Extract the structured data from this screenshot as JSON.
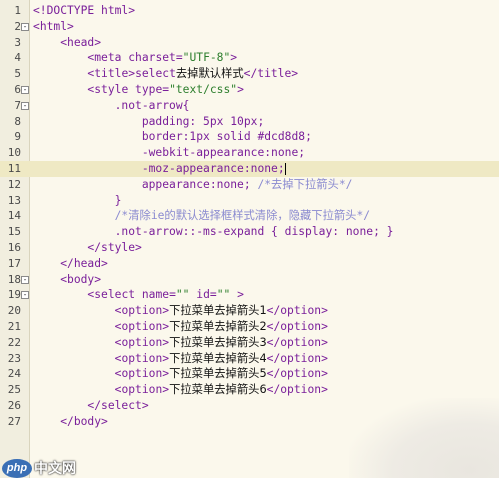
{
  "editor": {
    "current_line": 11,
    "lines": [
      {
        "n": "1",
        "fold": "",
        "parts": [
          [
            "br",
            "<!DOCTYPE html>"
          ]
        ]
      },
      {
        "n": "2",
        "fold": "-",
        "parts": [
          [
            "br",
            "<"
          ],
          [
            "tag",
            "html"
          ],
          [
            "br",
            ">"
          ]
        ]
      },
      {
        "n": "3",
        "fold": "",
        "parts": [
          [
            "ind",
            "    "
          ],
          [
            "br",
            "<"
          ],
          [
            "tag",
            "head"
          ],
          [
            "br",
            ">"
          ]
        ]
      },
      {
        "n": "4",
        "fold": "",
        "parts": [
          [
            "ind",
            "        "
          ],
          [
            "br",
            "<"
          ],
          [
            "tag",
            "meta "
          ],
          [
            "attr",
            "charset"
          ],
          [
            "br",
            "="
          ],
          [
            "val",
            "\"UTF-8\""
          ],
          [
            "br",
            ">"
          ]
        ]
      },
      {
        "n": "5",
        "fold": "",
        "parts": [
          [
            "ind",
            "        "
          ],
          [
            "br",
            "<"
          ],
          [
            "tag",
            "title"
          ],
          [
            "br",
            ">"
          ],
          [
            "tag",
            "select"
          ],
          [
            "txt",
            "去掉默认样式"
          ],
          [
            "br",
            "</"
          ],
          [
            "tag",
            "title"
          ],
          [
            "br",
            ">"
          ]
        ]
      },
      {
        "n": "6",
        "fold": "-",
        "parts": [
          [
            "ind",
            "        "
          ],
          [
            "br",
            "<"
          ],
          [
            "tag",
            "style "
          ],
          [
            "attr",
            "type"
          ],
          [
            "br",
            "="
          ],
          [
            "val",
            "\"text/css\""
          ],
          [
            "br",
            ">"
          ]
        ]
      },
      {
        "n": "7",
        "fold": "-",
        "parts": [
          [
            "ind",
            "            "
          ],
          [
            "sel",
            ".not-arrow{"
          ]
        ]
      },
      {
        "n": "8",
        "fold": "",
        "parts": [
          [
            "ind",
            "                "
          ],
          [
            "prop",
            "padding: 5px 10px;"
          ]
        ]
      },
      {
        "n": "9",
        "fold": "",
        "parts": [
          [
            "ind",
            "                "
          ],
          [
            "prop",
            "border:1px solid "
          ],
          [
            "hex",
            "#dcd8d8"
          ],
          [
            "prop",
            ";"
          ]
        ]
      },
      {
        "n": "10",
        "fold": "",
        "parts": [
          [
            "ind",
            "                "
          ],
          [
            "prop",
            "-webkit-appearance:none;"
          ]
        ]
      },
      {
        "n": "11",
        "fold": "",
        "parts": [
          [
            "ind",
            "                "
          ],
          [
            "prop",
            "-moz-appearance:none;"
          ],
          [
            "caret",
            ""
          ]
        ]
      },
      {
        "n": "12",
        "fold": "",
        "parts": [
          [
            "ind",
            "                "
          ],
          [
            "prop",
            "appearance:none; "
          ],
          [
            "cmt",
            "/*去掉下拉箭头*/"
          ]
        ]
      },
      {
        "n": "13",
        "fold": "",
        "parts": [
          [
            "ind",
            "            "
          ],
          [
            "sel",
            "}"
          ]
        ]
      },
      {
        "n": "14",
        "fold": "",
        "parts": [
          [
            "ind",
            "            "
          ],
          [
            "cmt",
            "/*清除ie的默认选择框样式清除，隐藏下拉箭头*/"
          ]
        ]
      },
      {
        "n": "15",
        "fold": "",
        "parts": [
          [
            "ind",
            "            "
          ],
          [
            "sel",
            ".not-arrow::-ms-expand { display: none; }"
          ]
        ]
      },
      {
        "n": "16",
        "fold": "",
        "parts": [
          [
            "ind",
            "        "
          ],
          [
            "br",
            "</"
          ],
          [
            "tag",
            "style"
          ],
          [
            "br",
            ">"
          ]
        ]
      },
      {
        "n": "17",
        "fold": "",
        "parts": [
          [
            "ind",
            "    "
          ],
          [
            "br",
            "</"
          ],
          [
            "tag",
            "head"
          ],
          [
            "br",
            ">"
          ]
        ]
      },
      {
        "n": "18",
        "fold": "-",
        "parts": [
          [
            "ind",
            "    "
          ],
          [
            "br",
            "<"
          ],
          [
            "tag",
            "body"
          ],
          [
            "br",
            ">"
          ]
        ]
      },
      {
        "n": "19",
        "fold": "-",
        "parts": [
          [
            "ind",
            "        "
          ],
          [
            "br",
            "<"
          ],
          [
            "tag",
            "select "
          ],
          [
            "attr",
            "name"
          ],
          [
            "br",
            "="
          ],
          [
            "val",
            "\"\""
          ],
          [
            "attr",
            " id"
          ],
          [
            "br",
            "="
          ],
          [
            "val",
            "\"\""
          ],
          [
            "br",
            " >"
          ]
        ]
      },
      {
        "n": "20",
        "fold": "",
        "parts": [
          [
            "ind",
            "            "
          ],
          [
            "br",
            "<"
          ],
          [
            "tag",
            "option"
          ],
          [
            "br",
            ">"
          ],
          [
            "txt",
            "下拉菜单去掉箭头1"
          ],
          [
            "br",
            "</"
          ],
          [
            "tag",
            "option"
          ],
          [
            "br",
            ">"
          ]
        ]
      },
      {
        "n": "21",
        "fold": "",
        "parts": [
          [
            "ind",
            "            "
          ],
          [
            "br",
            "<"
          ],
          [
            "tag",
            "option"
          ],
          [
            "br",
            ">"
          ],
          [
            "txt",
            "下拉菜单去掉箭头2"
          ],
          [
            "br",
            "</"
          ],
          [
            "tag",
            "option"
          ],
          [
            "br",
            ">"
          ]
        ]
      },
      {
        "n": "22",
        "fold": "",
        "parts": [
          [
            "ind",
            "            "
          ],
          [
            "br",
            "<"
          ],
          [
            "tag",
            "option"
          ],
          [
            "br",
            ">"
          ],
          [
            "txt",
            "下拉菜单去掉箭头3"
          ],
          [
            "br",
            "</"
          ],
          [
            "tag",
            "option"
          ],
          [
            "br",
            ">"
          ]
        ]
      },
      {
        "n": "23",
        "fold": "",
        "parts": [
          [
            "ind",
            "            "
          ],
          [
            "br",
            "<"
          ],
          [
            "tag",
            "option"
          ],
          [
            "br",
            ">"
          ],
          [
            "txt",
            "下拉菜单去掉箭头4"
          ],
          [
            "br",
            "</"
          ],
          [
            "tag",
            "option"
          ],
          [
            "br",
            ">"
          ]
        ]
      },
      {
        "n": "24",
        "fold": "",
        "parts": [
          [
            "ind",
            "            "
          ],
          [
            "br",
            "<"
          ],
          [
            "tag",
            "option"
          ],
          [
            "br",
            ">"
          ],
          [
            "txt",
            "下拉菜单去掉箭头5"
          ],
          [
            "br",
            "</"
          ],
          [
            "tag",
            "option"
          ],
          [
            "br",
            ">"
          ]
        ]
      },
      {
        "n": "25",
        "fold": "",
        "parts": [
          [
            "ind",
            "            "
          ],
          [
            "br",
            "<"
          ],
          [
            "tag",
            "option"
          ],
          [
            "br",
            ">"
          ],
          [
            "txt",
            "下拉菜单去掉箭头6"
          ],
          [
            "br",
            "</"
          ],
          [
            "tag",
            "option"
          ],
          [
            "br",
            ">"
          ]
        ]
      },
      {
        "n": "26",
        "fold": "",
        "parts": [
          [
            "ind",
            "        "
          ],
          [
            "br",
            "</"
          ],
          [
            "tag",
            "select"
          ],
          [
            "br",
            ">"
          ]
        ]
      },
      {
        "n": "27",
        "fold": "",
        "parts": [
          [
            "ind",
            "    "
          ],
          [
            "br",
            "</"
          ],
          [
            "tag",
            "body"
          ],
          [
            "br",
            ">"
          ]
        ]
      }
    ]
  },
  "watermark": {
    "logo_text": "php",
    "site_text": "中文网"
  }
}
